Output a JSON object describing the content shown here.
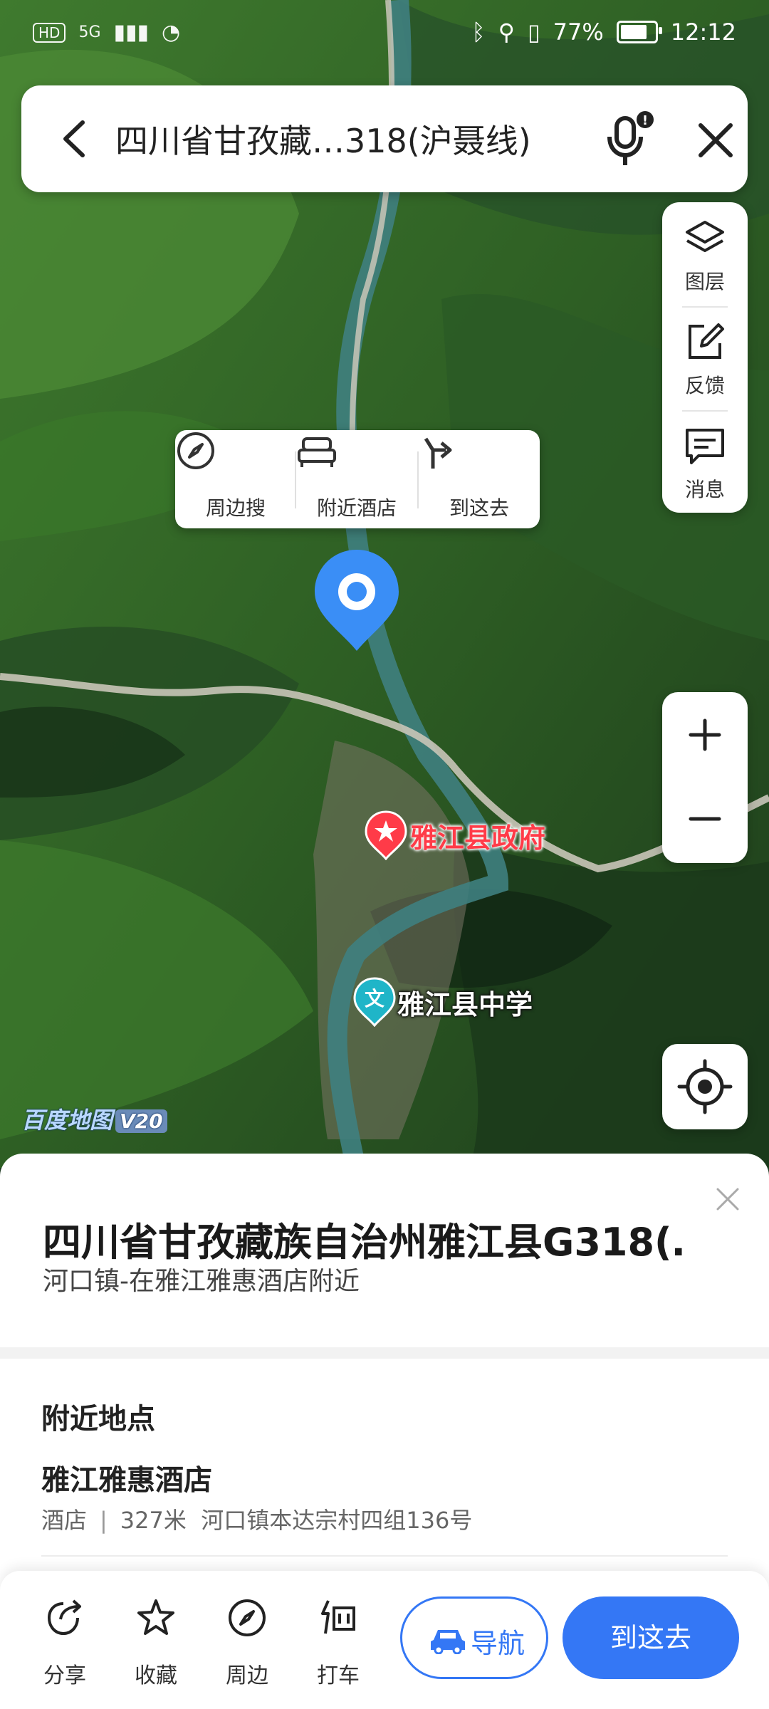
{
  "status_bar": {
    "network": "HD",
    "network_type": "5G",
    "battery": "77%",
    "time": "12:12"
  },
  "search": {
    "title": "四川省甘孜藏…318(沪聂线)",
    "back_icon": "back-arrow-icon",
    "mic_icon": "microphone-icon",
    "close_icon": "close-icon"
  },
  "side_panel": {
    "items": [
      {
        "label": "图层",
        "icon": "layers-icon"
      },
      {
        "label": "反馈",
        "icon": "feedback-edit-icon"
      },
      {
        "label": "消息",
        "icon": "message-icon"
      }
    ]
  },
  "popup": {
    "items": [
      {
        "label": "周边搜",
        "icon": "compass-icon"
      },
      {
        "label": "附近酒店",
        "icon": "bed-icon"
      },
      {
        "label": "到这去",
        "icon": "route-turn-icon"
      }
    ]
  },
  "map": {
    "govt_label": "雅江县政府",
    "school_label": "雅江县中学",
    "school_badge": "文",
    "watermark": "百度地图",
    "watermark_version": "V20",
    "colors": {
      "pin": "#3a8ef6",
      "govt": "#ff3b48",
      "school": "#1fb5c8"
    }
  },
  "sheet": {
    "place_name": "四川省甘孜藏族自治州雅江县G318(…",
    "place_sub": "河口镇-在雅江雅惠酒店附近",
    "nearby_title": "附近地点",
    "poi": {
      "name": "雅江雅惠酒店",
      "category": "酒店",
      "distance": "327米",
      "address": "河口镇本达宗村四组136号"
    }
  },
  "actions": {
    "items": [
      {
        "label": "分享",
        "icon": "share-icon"
      },
      {
        "label": "收藏",
        "icon": "star-icon"
      },
      {
        "label": "周边",
        "icon": "compass-icon"
      },
      {
        "label": "打车",
        "icon": "taxi-icon"
      }
    ],
    "navigate": "导航",
    "go_here": "到这去",
    "accent": "#3477f5"
  }
}
